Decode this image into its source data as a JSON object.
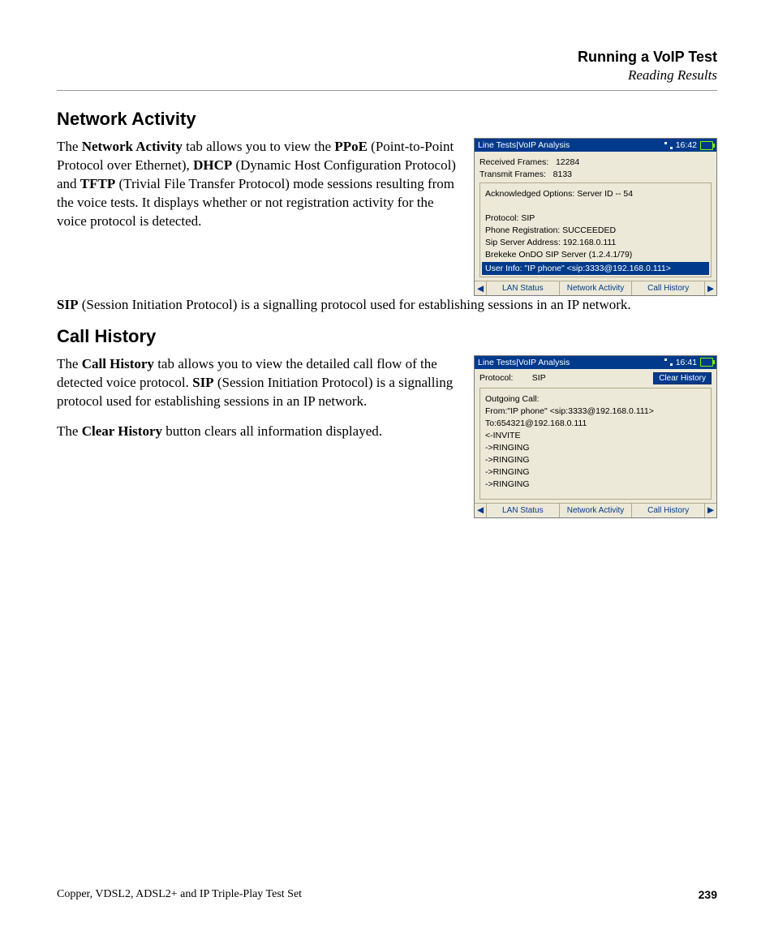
{
  "header": {
    "title": "Running a VoIP Test",
    "subtitle": "Reading Results"
  },
  "section1": {
    "heading": "Network Activity",
    "p1_a": "The ",
    "p1_b": "Network Activity",
    "p1_c": " tab allows you to view the ",
    "p1_d": "PPoE",
    "p1_e": " (Point-to-Point Protocol over Ethernet), ",
    "p1_f": "DHCP",
    "p1_g": " (Dynamic Host Configuration Protocol) and ",
    "p1_h": "TFTP",
    "p1_i": " (Trivial File Transfer Protocol) mode sessions resulting from the voice tests. It displays whether or not registration activity for the voice protocol is detected.",
    "p2_a": "SIP",
    "p2_b": " (Session Initiation Protocol) is a signalling protocol used for establishing sessions in an IP network."
  },
  "device1": {
    "title": "Line Tests|VoIP Analysis",
    "time": "16:42",
    "rx_label": "Received Frames:",
    "rx_val": "12284",
    "tx_label": "Transmit Frames:",
    "tx_val": "8133",
    "ack": "Acknowledged Options: Server ID -- 54",
    "proto": "Protocol: SIP",
    "reg": "Phone Registration:   SUCCEEDED",
    "addr": "Sip Server Address: 192.168.0.111",
    "srv": "Brekeke OnDO SIP Server (1.2.4.1/79)",
    "user": "User Info: \"IP phone\" <sip:3333@192.168.0.111>",
    "tabs": [
      "LAN Status",
      "Network Activity",
      "Call History"
    ]
  },
  "section2": {
    "heading": "Call History",
    "p1_a": "The ",
    "p1_b": "Call History",
    "p1_c": " tab allows you to view the detailed call flow of the detected voice protocol. ",
    "p1_d": "SIP",
    "p1_e": " (Session Initiation Protocol) is a signalling protocol used for establishing sessions in an IP network.",
    "p2_a": "The ",
    "p2_b": "Clear History",
    "p2_c": " button clears all information displayed."
  },
  "device2": {
    "title": "Line Tests|VoIP Analysis",
    "time": "16:41",
    "proto_label": "Protocol:",
    "proto_val": "SIP",
    "clear": "Clear History",
    "lines": [
      "Outgoing Call:",
      "From:\"IP phone\" <sip:3333@192.168.0.111>",
      "To:654321@192.168.0.111",
      "<-INVITE",
      "->RINGING",
      "->RINGING",
      "->RINGING",
      "->RINGING"
    ],
    "tabs": [
      "LAN Status",
      "Network Activity",
      "Call History"
    ]
  },
  "footer": {
    "product": "Copper, VDSL2, ADSL2+ and IP Triple-Play Test Set",
    "page": "239"
  }
}
